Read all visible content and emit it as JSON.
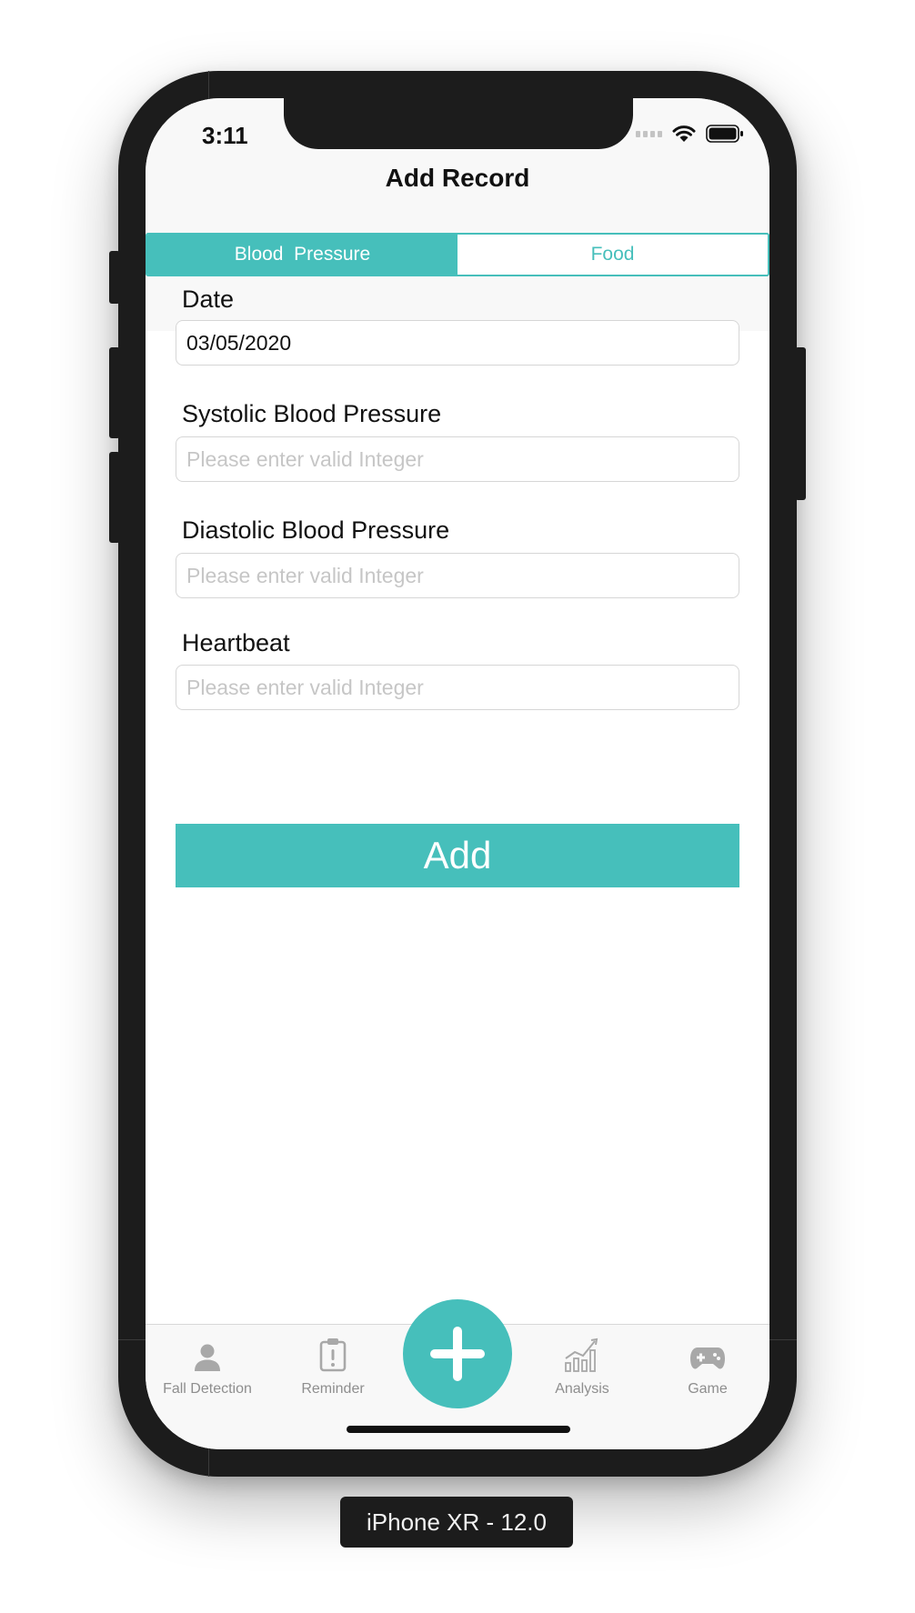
{
  "status_bar": {
    "time": "3:11"
  },
  "header": {
    "title": "Add Record",
    "segments": [
      {
        "label": "Blood  Pressure",
        "selected": true
      },
      {
        "label": "Food",
        "selected": false
      }
    ]
  },
  "form": {
    "date": {
      "label": "Date",
      "value": "03/05/2020"
    },
    "systolic": {
      "label": "Systolic Blood Pressure",
      "placeholder": "Please enter valid Integer",
      "value": ""
    },
    "diastolic": {
      "label": "Diastolic Blood Pressure",
      "placeholder": "Please enter valid Integer",
      "value": ""
    },
    "heartbeat": {
      "label": "Heartbeat",
      "placeholder": "Please enter valid Integer",
      "value": ""
    },
    "submit_label": "Add"
  },
  "tabbar": {
    "items": [
      {
        "label": "Fall Detection",
        "icon": "person-icon"
      },
      {
        "label": "Reminder",
        "icon": "clipboard-alert-icon"
      },
      {
        "label": "",
        "icon": "plus-icon"
      },
      {
        "label": "Analysis",
        "icon": "bar-chart-icon"
      },
      {
        "label": "Game",
        "icon": "gamepad-icon"
      }
    ]
  },
  "device_label": "iPhone XR - 12.0",
  "colors": {
    "accent": "#46bfbb",
    "frame": "#1c1c1c",
    "tab_inactive": "#8e8e8e"
  }
}
